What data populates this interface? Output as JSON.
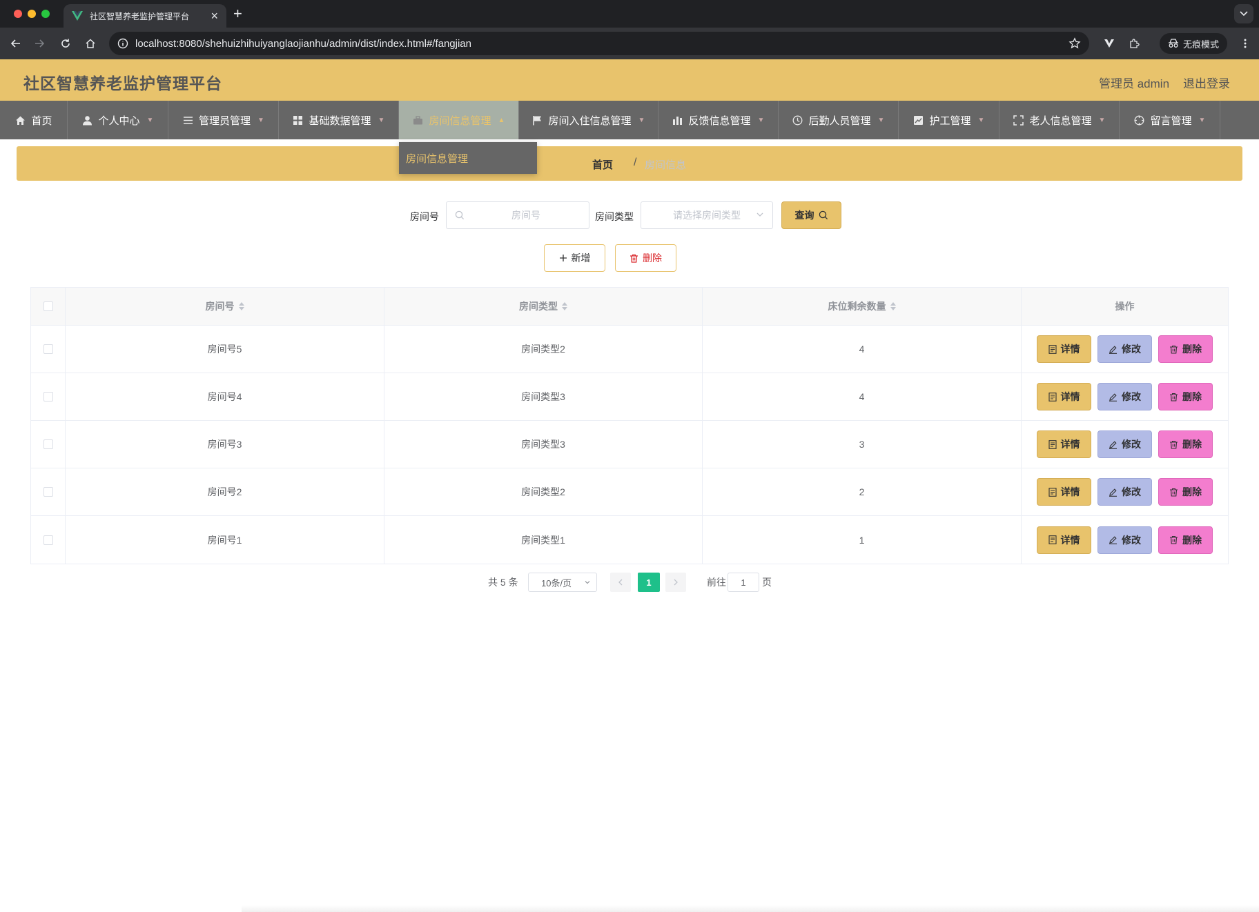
{
  "browser": {
    "tab_title": "社区智慧养老监护管理平台",
    "url": "localhost:8080/shehuizhihuiyanglaojianhu/admin/dist/index.html#/fangjian",
    "incognito_label": "无痕模式"
  },
  "header": {
    "title": "社区智慧养老监护管理平台",
    "admin_label": "管理员 admin",
    "logout_label": "退出登录",
    "bg_color": "#e8c36c"
  },
  "nav": {
    "items": [
      {
        "label": "首页",
        "icon": "home-icon"
      },
      {
        "label": "个人中心",
        "icon": "user-icon"
      },
      {
        "label": "管理员管理",
        "icon": "list-icon"
      },
      {
        "label": "基础数据管理",
        "icon": "grid-icon"
      },
      {
        "label": "房间信息管理",
        "icon": "briefcase-icon",
        "active": true
      },
      {
        "label": "房间入住信息管理",
        "icon": "flag-icon"
      },
      {
        "label": "反馈信息管理",
        "icon": "chart-icon"
      },
      {
        "label": "后勤人员管理",
        "icon": "clock-icon"
      },
      {
        "label": "护工管理",
        "icon": "trend-icon"
      },
      {
        "label": "老人信息管理",
        "icon": "fullscreen-icon"
      },
      {
        "label": "留言管理",
        "icon": "aim-icon"
      }
    ],
    "dropdown_item": "房间信息管理"
  },
  "breadcrumb": {
    "home": "首页",
    "separator": "/",
    "current": "房间信息"
  },
  "search": {
    "room_no_label": "房间号",
    "room_no_placeholder": "房间号",
    "room_type_label": "房间类型",
    "room_type_placeholder": "请选择房间类型",
    "query_label": "查询"
  },
  "actions": {
    "add_label": "新增",
    "delete_label": "删除"
  },
  "table": {
    "columns": [
      "房间号",
      "房间类型",
      "床位剩余数量",
      "操作"
    ],
    "rows": [
      {
        "room_no": "房间号5",
        "room_type": "房间类型2",
        "beds_left": "4"
      },
      {
        "room_no": "房间号4",
        "room_type": "房间类型3",
        "beds_left": "4"
      },
      {
        "room_no": "房间号3",
        "room_type": "房间类型3",
        "beds_left": "3"
      },
      {
        "room_no": "房间号2",
        "room_type": "房间类型2",
        "beds_left": "2"
      },
      {
        "room_no": "房间号1",
        "room_type": "房间类型1",
        "beds_left": "1"
      }
    ],
    "op_labels": {
      "detail": "详情",
      "edit": "修改",
      "delete": "删除"
    }
  },
  "pagination": {
    "total_text": "共 5 条",
    "page_size": "10条/页",
    "current_page": "1",
    "goto_label": "前往",
    "goto_value": "1",
    "page_unit": "页",
    "active_color": "#1ec08a"
  }
}
